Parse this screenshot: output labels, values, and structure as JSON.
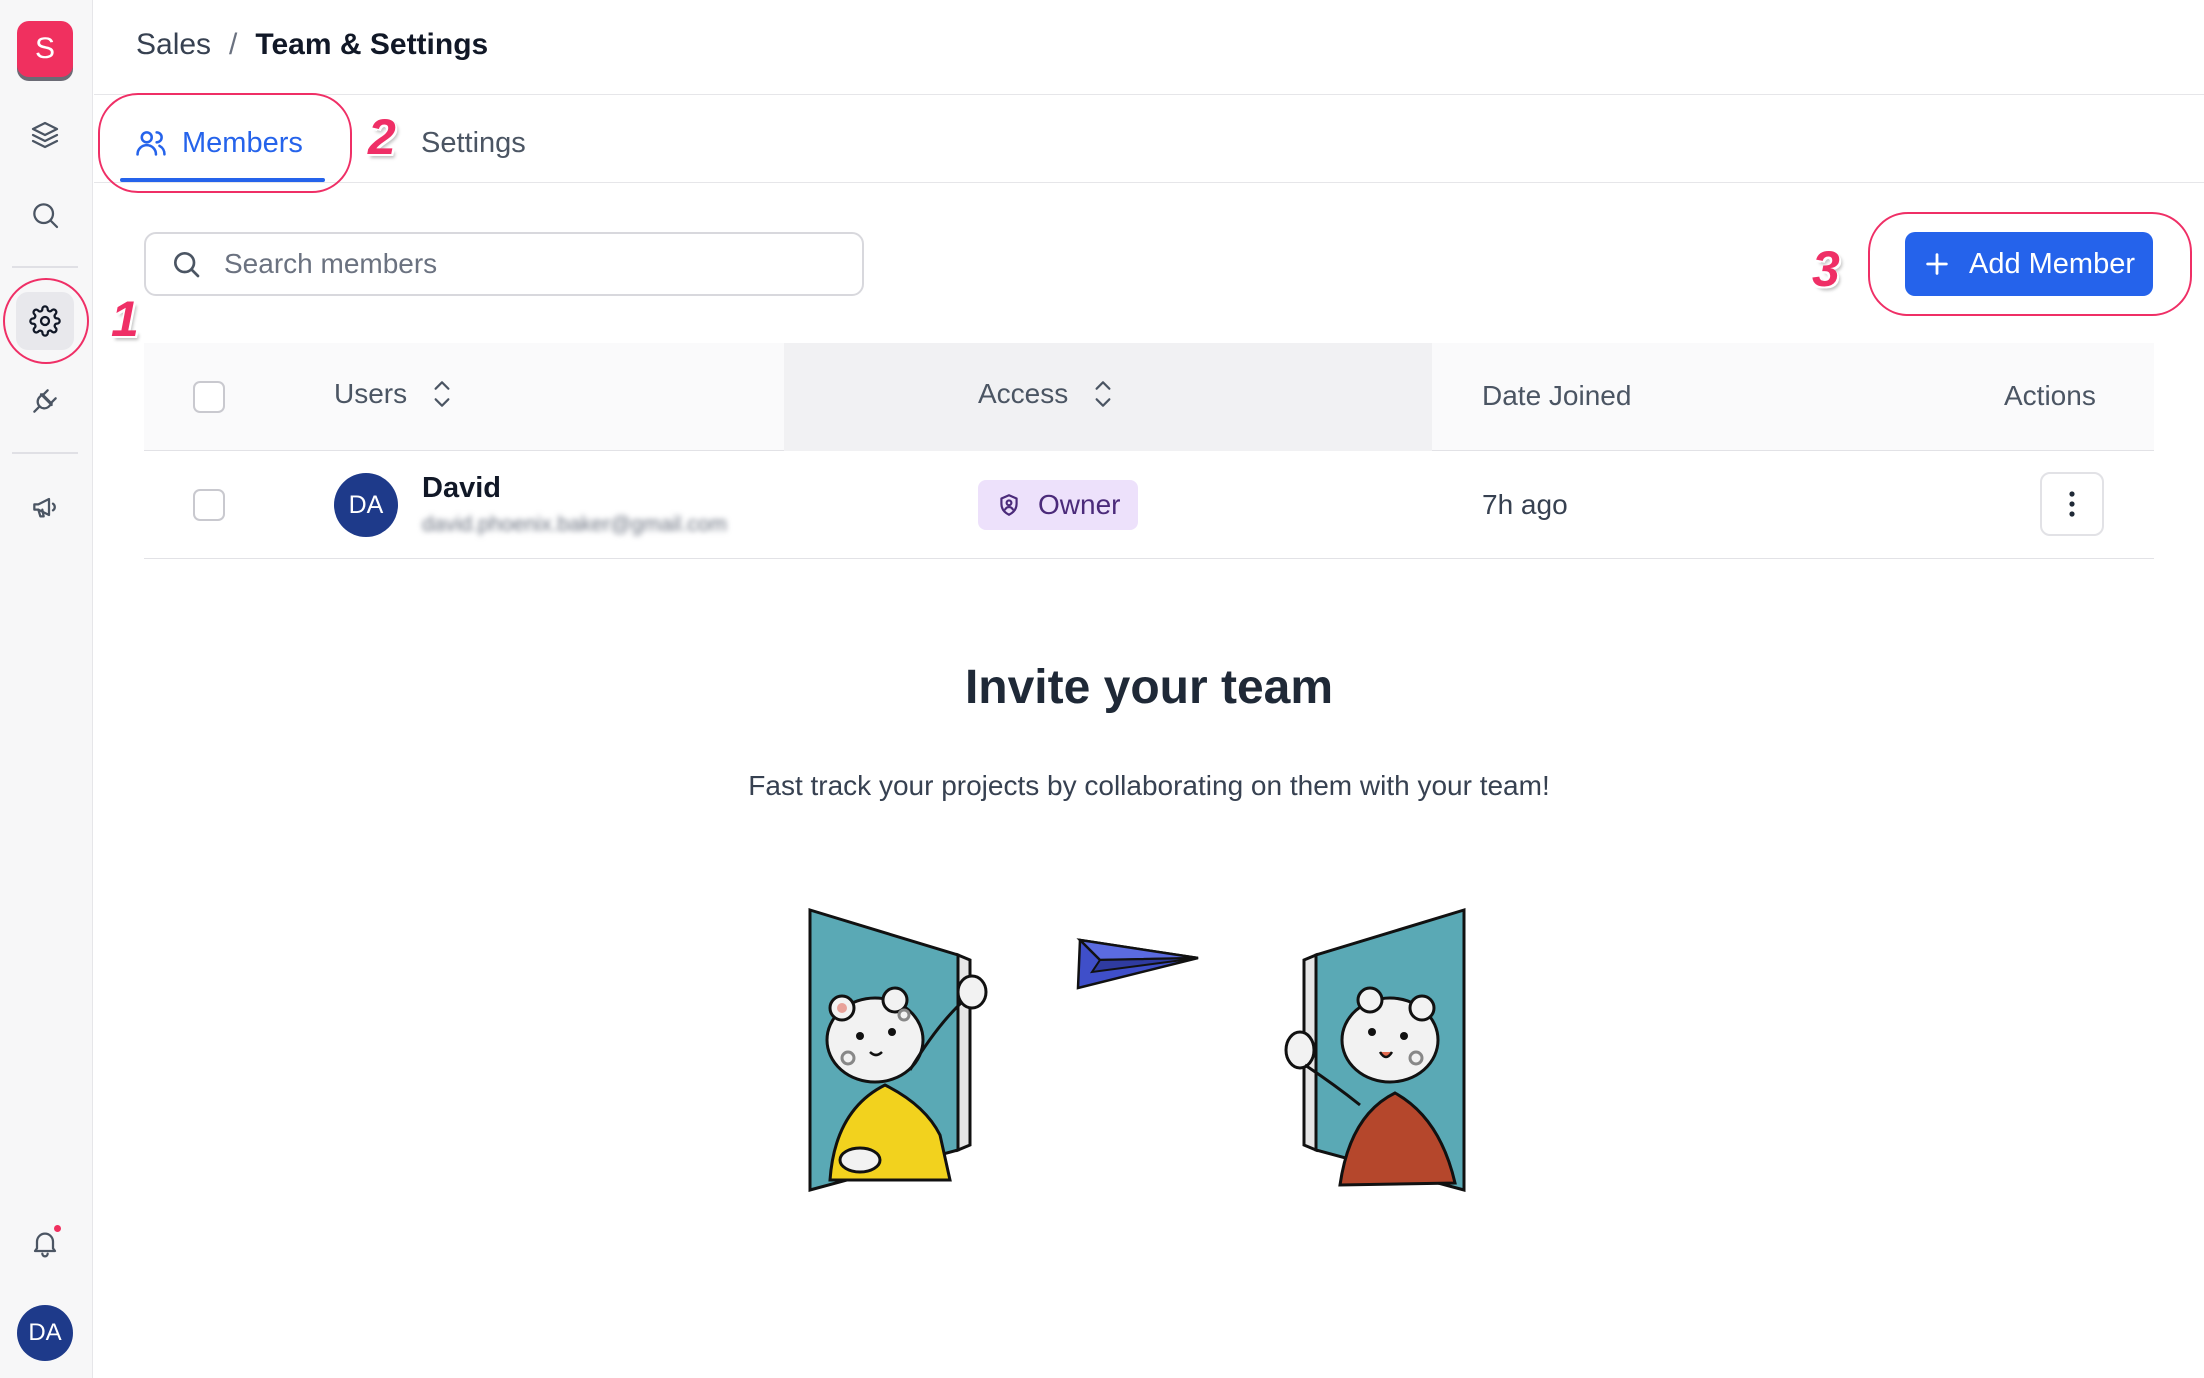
{
  "sidebar": {
    "logo_letter": "S",
    "avatar_initials": "DA"
  },
  "breadcrumb": {
    "parent": "Sales",
    "separator": "/",
    "current": "Team & Settings"
  },
  "tabs": [
    {
      "label": "Members",
      "active": true
    },
    {
      "label": "Settings",
      "active": false
    }
  ],
  "annotations": [
    "1",
    "2",
    "3"
  ],
  "search": {
    "placeholder": "Search members",
    "value": ""
  },
  "add_member": {
    "label": "Add Member"
  },
  "table": {
    "columns": [
      "Users",
      "Access",
      "Date Joined",
      "Actions"
    ],
    "rows": [
      {
        "initials": "DA",
        "name": "David",
        "email": "david.phoenix.baker@gmail.com",
        "access": "Owner",
        "date_joined": "7h ago"
      }
    ]
  },
  "empty_state": {
    "title": "Invite your team",
    "subtitle": "Fast track your projects by collaborating on them with your team!"
  },
  "colors": {
    "accent": "#2563eb",
    "brand": "#f0305f",
    "annotation": "#ef2f66",
    "owner_badge": "#ede1fb"
  }
}
